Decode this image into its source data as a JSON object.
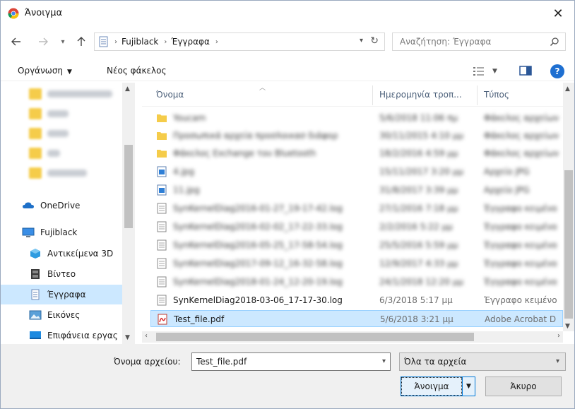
{
  "window": {
    "title": "Άνοιγμα",
    "close_label": "✕"
  },
  "nav": {
    "back_icon": "arrow-left-icon",
    "forward_icon": "arrow-right-icon",
    "up_icon": "arrow-up-icon",
    "breadcrumbs": [
      "Fujiblack",
      "Έγγραφα"
    ],
    "search_placeholder": "Αναζήτηση: Έγγραφα"
  },
  "toolbar": {
    "organize_label": "Οργάνωση",
    "new_folder_label": "Νέος φάκελος",
    "help_label": "?"
  },
  "sidebar": {
    "items": [
      {
        "label": "OneDrive",
        "icon": "cloud-icon"
      },
      {
        "label": "Fujiblack",
        "icon": "computer-icon"
      },
      {
        "label": "Αντικείμενα 3D",
        "icon": "cube-icon"
      },
      {
        "label": "Βίντεο",
        "icon": "video-icon"
      },
      {
        "label": "Έγγραφα",
        "icon": "document-icon"
      },
      {
        "label": "Εικόνες",
        "icon": "pictures-icon"
      },
      {
        "label": "Επιφάνεια εργας",
        "icon": "desktop-icon"
      }
    ]
  },
  "filelist": {
    "columns": {
      "name": "Όνομα",
      "date": "Ημερομηνία τροπ...",
      "type": "Τύπος"
    },
    "rows": [
      {
        "name": "Youcam",
        "date": "5/6/2018 11:06 πμ",
        "type": "Φάκελος αρχείων"
      },
      {
        "name": "Προσωπικά αρχεία προσλοικασ διάφορ",
        "date": "30/11/2015 4:10 μμ",
        "type": "Φάκελος αρχείων"
      },
      {
        "name": "Φάκελος Exchange του Bluetooth",
        "date": "18/2/2016 4:59 μμ",
        "type": "Φάκελος αρχείων"
      },
      {
        "name": "4.jpg",
        "date": "15/11/2017 3:20 μμ",
        "type": "Αρχείο JPG"
      },
      {
        "name": "11.jpg",
        "date": "31/8/2017 3:39 μμ",
        "type": "Αρχείο JPG"
      },
      {
        "name": "SynKernelDiag2016-01-27_19-17-42.log",
        "date": "27/1/2016 7:18 μμ",
        "type": "Έγγραφο κειμένο"
      },
      {
        "name": "SynKernelDiag2016-02-02_17-22-33.log",
        "date": "2/2/2016 5:22 μμ",
        "type": "Έγγραφο κειμένο"
      },
      {
        "name": "SynKernelDiag2016-05-25_17-58-54.log",
        "date": "25/5/2016 5:59 μμ",
        "type": "Έγγραφο κειμένο"
      },
      {
        "name": "SynKernelDiag2017-09-12_16-32-58.log",
        "date": "12/9/2017 4:33 μμ",
        "type": "Έγγραφο κειμένο"
      },
      {
        "name": "SynKernelDiag2018-01-24_12-20-19.log",
        "date": "24/1/2018 12:20 μμ",
        "type": "Έγγραφο κειμένο"
      },
      {
        "name": "SynKernelDiag2018-03-06_17-17-30.log",
        "date": "6/3/2018 5:17 μμ",
        "type": "Έγγραφο κειμένο"
      },
      {
        "name": "Test_file.pdf",
        "date": "5/6/2018 3:21 μμ",
        "type": "Adobe Acrobat D"
      }
    ]
  },
  "footer": {
    "filename_label": "Όνομα αρχείου:",
    "filename_value": "Test_file.pdf",
    "filetype_value": "Όλα τα αρχεία",
    "open_label": "Άνοιγμα",
    "cancel_label": "Άκυρο"
  },
  "colors": {
    "selection": "#cce8ff",
    "accent": "#0078d7",
    "help": "#1e6fd1"
  }
}
